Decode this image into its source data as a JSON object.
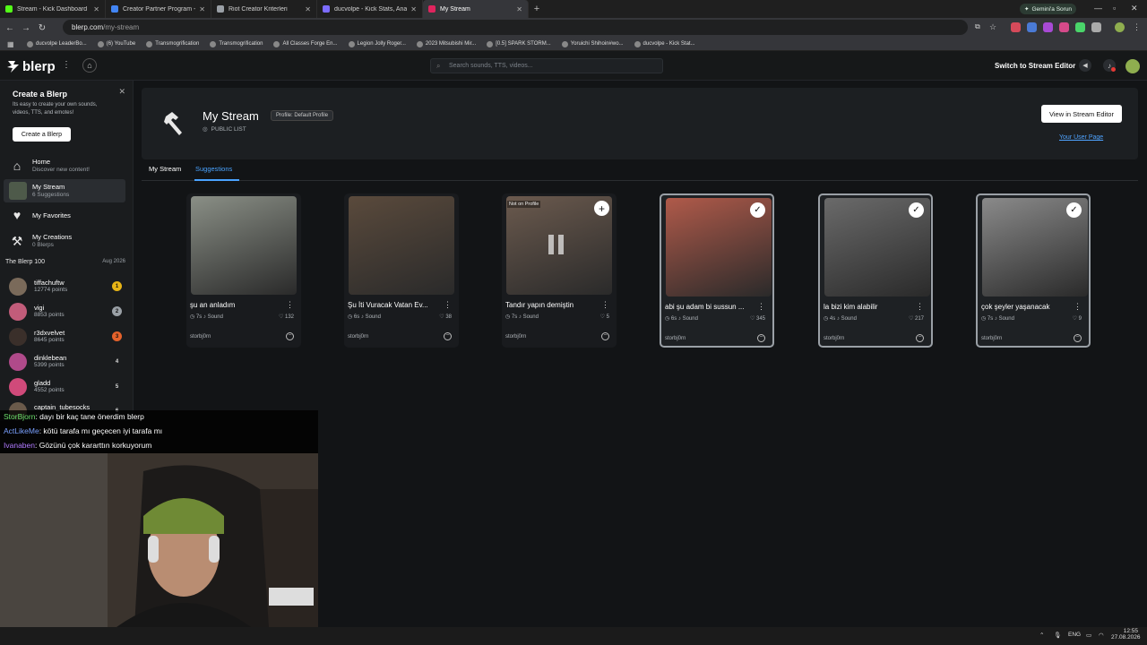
{
  "browser": {
    "tabs": [
      {
        "title": "Stream - Kick Dashboard",
        "color": "#53fc18"
      },
      {
        "title": "Creator Partner Program - Qua",
        "color": "#4285f4"
      },
      {
        "title": "Riot Creator Kriterleri",
        "color": "#9aa0a6"
      },
      {
        "title": "ducvolpe - Kick Stats, Analytic",
        "color": "#7c6cff"
      },
      {
        "title": "My Stream",
        "color": "#e0245e",
        "active": true
      }
    ],
    "gemini": "Gemini'a Sorun",
    "url_host": "blerp.com",
    "url_path": "/my-stream",
    "bookmarks": [
      "ducvolpe LeaderBo...",
      "(6) YouTube",
      "Transmogrification",
      "Transmogrification",
      "All Classes Forge En...",
      "Legion Jolly Roger...",
      "2023 Mitsubishi Mir...",
      "[0.5] SPARK STORM...",
      "Yoruichi Shihoin#wo...",
      "ducvolpe - Kick Stat..."
    ]
  },
  "app": {
    "logo": "blerp",
    "search_placeholder": "Search sounds, TTS, videos...",
    "switch_label": "Switch to Stream Editor"
  },
  "sidebar": {
    "promo": {
      "title": "Create a Blerp",
      "text": "Its easy to create your own sounds, videos, TTS, and emotes!",
      "button": "Create a Blerp"
    },
    "items": [
      {
        "label": "Home",
        "sub": "Discover new content!"
      },
      {
        "label": "My Stream",
        "sub": "6 Suggestions"
      },
      {
        "label": "My Favorites",
        "sub": ""
      },
      {
        "label": "My Creations",
        "sub": "0 Blerps"
      }
    ],
    "blerp100_title": "The Blerp 100",
    "blerp100_date": "Aug 2026",
    "ranks": [
      {
        "name": "tiffachuftw",
        "points": "12774 points",
        "rank": "1",
        "color": "#e7b416",
        "avatar": "#7a6a5a"
      },
      {
        "name": "vigi",
        "points": "8853 points",
        "rank": "2",
        "color": "#9aa0a6",
        "avatar": "#c25c7a"
      },
      {
        "name": "r3dxvelvet",
        "points": "8645 points",
        "rank": "3",
        "color": "#e5622b",
        "avatar": "#3a2f2a"
      },
      {
        "name": "dinklebean",
        "points": "5399 points",
        "rank": "4",
        "color": "",
        "avatar": "#b04a8a"
      },
      {
        "name": "gladd",
        "points": "4552 points",
        "rank": "5",
        "color": "",
        "avatar": "#d04a7a"
      },
      {
        "name": "captain_tubesocks",
        "points": "",
        "rank": "6",
        "color": "",
        "avatar": "#6a5a4a"
      }
    ]
  },
  "header": {
    "title": "My Stream",
    "profile": "Profile: Default Profile",
    "public": "PUBLIC LIST",
    "view_button": "View in Stream Editor",
    "user_page": "Your User Page"
  },
  "tabs": {
    "my_stream": "My Stream",
    "suggestions": "Suggestions"
  },
  "cards": [
    {
      "title": "şu an anladım",
      "duration": "7s",
      "type": "Sound",
      "likes": "132",
      "author": "storbj0rn",
      "state": "none",
      "img": "#8a8f86"
    },
    {
      "title": "Şu İti Vuracak Vatan Ev...",
      "duration": "6s",
      "type": "Sound",
      "likes": "38",
      "author": "storbj0rn",
      "state": "none",
      "img": "#5a4a3c"
    },
    {
      "title": "Tandır yapın demiştin",
      "duration": "7s",
      "type": "Sound",
      "likes": "5",
      "author": "storbj0rn",
      "state": "add",
      "img": "#6b5a4e",
      "badge": "Not on Profile"
    },
    {
      "title": "abi şu adam bi sussun ...",
      "duration": "6s",
      "type": "Sound",
      "likes": "345",
      "author": "storbj0rn",
      "state": "checked",
      "img": "#b05a4a"
    },
    {
      "title": "la bizi kim alabilir",
      "duration": "4s",
      "type": "Sound",
      "likes": "217",
      "author": "storbj0rn",
      "state": "checked",
      "img": "#6a6a6a"
    },
    {
      "title": "çok şeyler yaşanacak",
      "duration": "7s",
      "type": "Sound",
      "likes": "9",
      "author": "storbj0rn",
      "state": "checked",
      "img": "#8a8a8a"
    }
  ],
  "chat": [
    {
      "user": "StorBjorn",
      "color": "#6ce06c",
      "msg": ": dayı bir kaç tane önerdim blerp"
    },
    {
      "user": "ActLikeMe",
      "color": "#7aa0ff",
      "msg": ": kötü tarafa mı geçecen iyi tarafa mı"
    },
    {
      "user": "Ivanaben",
      "color": "#b07aff",
      "msg": ": Gözünü çok kararttın korkuyorum"
    }
  ],
  "taskbar": {
    "lang": "ENG",
    "time": "12:55",
    "date": "27.08.2026"
  }
}
